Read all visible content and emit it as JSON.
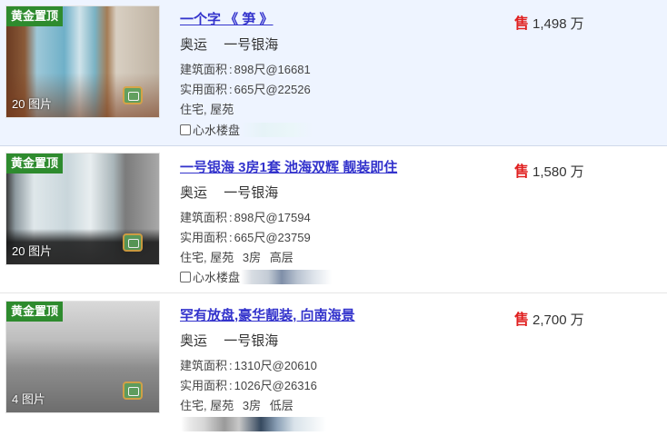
{
  "listings": [
    {
      "badge": "黄金置顶",
      "photo_count": "20 图片",
      "title": "一个字 《 笋 》",
      "district": "奥运",
      "estate": "一号银海",
      "gross_label": "建筑面积",
      "gross_value": "898尺@16681",
      "net_label": "实用面积",
      "net_value": "665尺@22526",
      "tags": [
        "住宅, 屋苑"
      ],
      "checkbox_label": "心水楼盘",
      "sale_label": "售",
      "price": "1,498",
      "price_unit": "万"
    },
    {
      "badge": "黄金置顶",
      "photo_count": "20 图片",
      "title": "一号银海 3房1套 池海双辉 靓装即住",
      "district": "奥运",
      "estate": "一号银海",
      "gross_label": "建筑面积",
      "gross_value": "898尺@17594",
      "net_label": "实用面积",
      "net_value": "665尺@23759",
      "tags": [
        "住宅, 屋苑",
        "3房",
        "高层"
      ],
      "checkbox_label": "心水楼盘",
      "sale_label": "售",
      "price": "1,580",
      "price_unit": "万"
    },
    {
      "badge": "黄金置顶",
      "photo_count": "4 图片",
      "title": "罕有放盘,豪华靓装, 向南海景",
      "district": "奥运",
      "estate": "一号银海",
      "gross_label": "建筑面积",
      "gross_value": "1310尺@20610",
      "net_label": "实用面积",
      "net_value": "1026尺@26316",
      "tags": [
        "住宅, 屋苑",
        "3房",
        "低层"
      ],
      "checkbox_label": "",
      "sale_label": "售",
      "price": "2,700",
      "price_unit": "万"
    }
  ],
  "colors": {
    "badge_bg": "#2e8b2e",
    "title_link": "#3333cc",
    "sale_red": "#e02020",
    "highlight_bg": "#eef4ff"
  }
}
